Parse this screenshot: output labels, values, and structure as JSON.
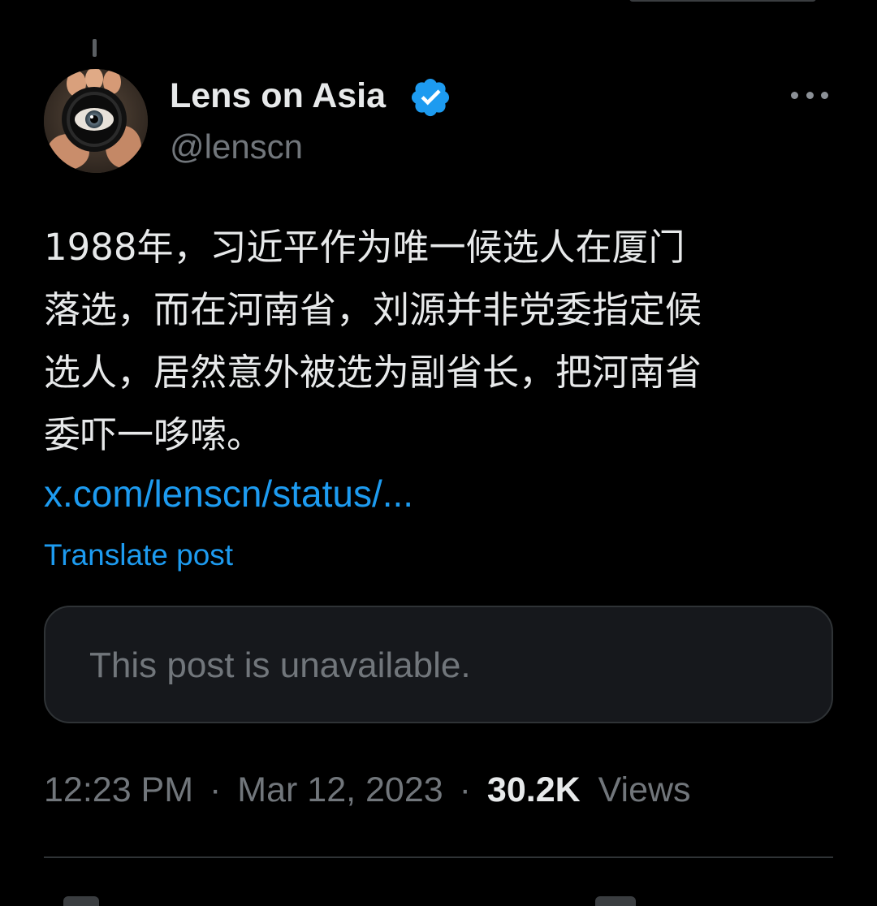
{
  "author": {
    "display_name": "Lens on Asia",
    "handle": "@lenscn",
    "verified": true,
    "avatar_icon": "eye-camera-lens-avatar"
  },
  "post": {
    "text_lines": [
      "1988年，习近平作为唯一候选人在厦门",
      "落选，而在河南省，刘源并非党委指定候",
      "选人，居然意外被选为副省长，把河南省",
      "委吓一哆嗦。"
    ],
    "link_text": "x.com/lenscn/status/...",
    "translate_label": "Translate post",
    "quoted_post_message": "This post is unavailable."
  },
  "meta": {
    "time": "12:23 PM",
    "separator": "·",
    "date": "Mar 12, 2023",
    "views_count": "30.2K",
    "views_label": "Views"
  },
  "icons": {
    "more": "more-horizontal-icon",
    "verified": "verified-badge-icon"
  },
  "colors": {
    "background": "#000000",
    "text_primary": "#e7e9ea",
    "text_secondary": "#71767b",
    "accent_blue": "#1d9bf0",
    "card_background": "#16181c",
    "border": "#2f3336"
  }
}
